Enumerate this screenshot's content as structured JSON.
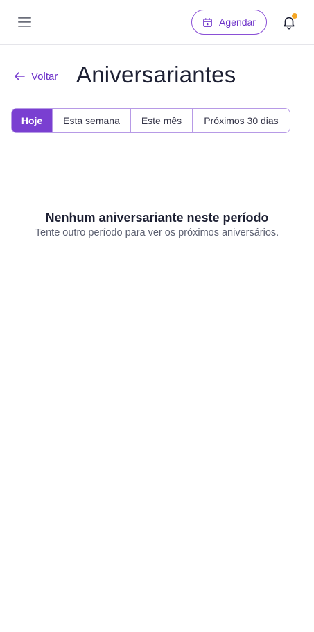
{
  "header": {
    "menu_icon": "hamburger-menu-icon",
    "schedule_button": {
      "label": "Agendar",
      "icon": "calendar-plus-icon"
    },
    "notifications": {
      "icon": "bell-icon",
      "has_unread": true,
      "badge_color": "#f5a623"
    }
  },
  "page": {
    "back_label": "Voltar",
    "title": "Aniversariantes"
  },
  "filters": {
    "tabs": [
      {
        "label": "Hoje",
        "active": true
      },
      {
        "label": "Esta semana",
        "active": false
      },
      {
        "label": "Este mês",
        "active": false
      },
      {
        "label": "Próximos 30 dias",
        "active": false
      }
    ]
  },
  "empty_state": {
    "title": "Nenhum aniversariante neste período",
    "subtitle": "Tente outro período para ver os próximos aniversários."
  },
  "colors": {
    "accent": "#7a3fd1",
    "accent_text": "#6d32c9",
    "notification_dot": "#f5a623"
  }
}
